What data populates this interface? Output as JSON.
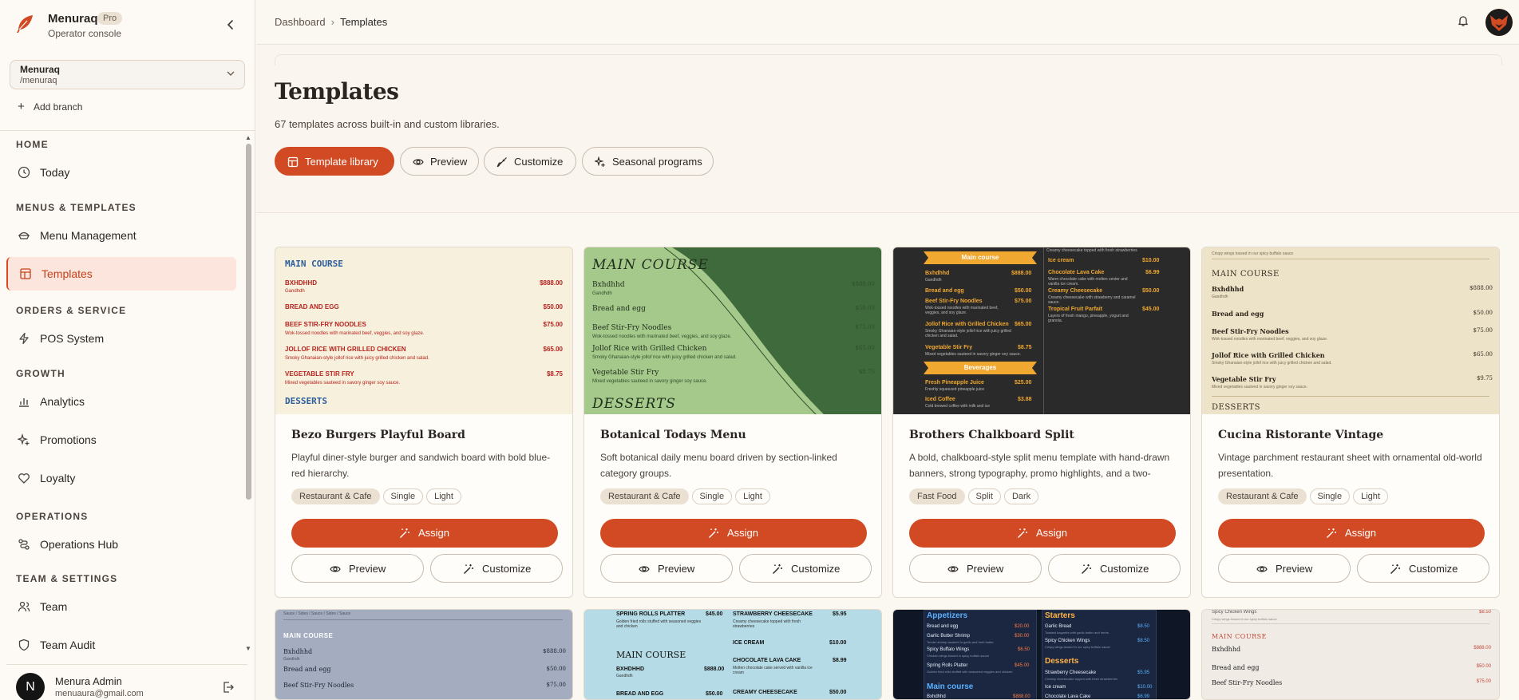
{
  "brand": {
    "name": "Menuraq",
    "badge": "Pro",
    "subtitle": "Operator console"
  },
  "branch": {
    "name": "Menuraq",
    "path": "/menuraq",
    "add_label": "Add branch"
  },
  "nav": {
    "sections": [
      {
        "title": "HOME",
        "items": [
          {
            "label": "Today",
            "icon": "clock-icon"
          }
        ]
      },
      {
        "title": "MENUS & TEMPLATES",
        "items": [
          {
            "label": "Menu Management",
            "icon": "menu-bowl-icon"
          },
          {
            "label": "Templates",
            "icon": "layout-icon",
            "active": true
          }
        ]
      },
      {
        "title": "ORDERS & SERVICE",
        "items": [
          {
            "label": "POS System",
            "icon": "bolt-icon"
          }
        ]
      },
      {
        "title": "GROWTH",
        "items": [
          {
            "label": "Analytics",
            "icon": "bar-chart-icon"
          },
          {
            "label": "Promotions",
            "icon": "sparkle-icon"
          },
          {
            "label": "Loyalty",
            "icon": "heart-icon"
          }
        ]
      },
      {
        "title": "OPERATIONS",
        "items": [
          {
            "label": "Operations Hub",
            "icon": "route-icon"
          }
        ]
      },
      {
        "title": "TEAM & SETTINGS",
        "items": [
          {
            "label": "Team",
            "icon": "users-icon"
          },
          {
            "label": "Team Audit",
            "icon": "shield-icon"
          }
        ]
      }
    ]
  },
  "user": {
    "initial": "N",
    "name": "Menura Admin",
    "email": "menuaura@gmail.com"
  },
  "breadcrumb": {
    "root": "Dashboard",
    "current": "Templates"
  },
  "page": {
    "title": "Templates",
    "subtitle": "67 templates across built-in and custom libraries.",
    "tabs": [
      {
        "label": "Template library",
        "icon": "template-icon",
        "active": true
      },
      {
        "label": "Preview",
        "icon": "eye-icon"
      },
      {
        "label": "Customize",
        "icon": "brush-icon"
      },
      {
        "label": "Seasonal programs",
        "icon": "sparkle-icon"
      }
    ]
  },
  "card_actions": {
    "assign": "Assign",
    "preview": "Preview",
    "customize": "Customize"
  },
  "cards": [
    {
      "title": "Bezo Burgers Playful Board",
      "desc": "Playful diner-style burger and sandwich board with bold blue-red hierarchy.",
      "tags": [
        "Restaurant & Cafe",
        "Single",
        "Light"
      ],
      "preview": {
        "sec1": "MAIN COURSE",
        "items": [
          {
            "name": "BXHDHHD",
            "price": "$888.00",
            "desc": "Gandhdh"
          },
          {
            "name": "BREAD AND EGG",
            "price": "$50.00",
            "desc": ""
          },
          {
            "name": "BEEF STIR-FRY NOODLES",
            "price": "$75.00",
            "desc": "Wok-tossed noodles with marinated beef, veggies, and soy glaze."
          },
          {
            "name": "JOLLOF RICE WITH GRILLED CHICKEN",
            "price": "$65.00",
            "desc": "Smoky Ghanaian-style jollof rice with juicy grilled chicken and salad."
          },
          {
            "name": "VEGETABLE STIR FRY",
            "price": "$8.75",
            "desc": "Mixed vegetables sauteed in savory ginger soy sauce."
          }
        ],
        "sec2": "DESSERTS"
      }
    },
    {
      "title": "Botanical Todays Menu",
      "desc": "Soft botanical daily menu board driven by section-linked category groups.",
      "tags": [
        "Restaurant & Cafe",
        "Single",
        "Light"
      ],
      "preview": {
        "sec1": "MAIN COURSE",
        "items": [
          {
            "name": "Bxhdhhd",
            "price": "$888.00",
            "desc": "Gandhdh"
          },
          {
            "name": "Bread and egg",
            "price": "$50.00",
            "desc": ""
          },
          {
            "name": "Beef Stir-Fry Noodles",
            "price": "$75.00",
            "desc": "Wok-tossed noodles with marinated beef, veggies, and soy glaze."
          },
          {
            "name": "Jollof Rice with Grilled Chicken",
            "price": "$65.00",
            "desc": "Smoky Ghanaian-style jollof rice with juicy grilled chicken and salad."
          },
          {
            "name": "Vegetable Stir Fry",
            "price": "$8.75",
            "desc": "Mixed vegetables sauteed in savory ginger soy sauce."
          }
        ],
        "sec2": "DESSERTS"
      }
    },
    {
      "title": "Brothers Chalkboard Split",
      "desc": "A bold, chalkboard-style split menu template with hand-drawn banners, strong typography, promo highlights, and a two-column…",
      "tags": [
        "Fast Food",
        "Split",
        "Dark"
      ],
      "preview": {
        "top_note": "Creamy cheesecake topped with fresh strawberries",
        "banner1": "Main course",
        "left": [
          {
            "name": "Bxhdhhd",
            "price": "$888.00",
            "desc": "Gandhdh"
          },
          {
            "name": "Bread and egg",
            "price": "$50.00",
            "desc": ""
          },
          {
            "name": "Beef Stir-Fry Noodles",
            "price": "$75.00",
            "desc": "Wok-tossed noodles with marinated beef, veggies, and soy glaze."
          },
          {
            "name": "Jollof Rice with Grilled Chicken",
            "price": "$65.00",
            "desc": "Smoky Ghanaian-style jollof rice with juicy grilled chicken and salad."
          },
          {
            "name": "Vegetable Stir Fry",
            "price": "$8.75",
            "desc": "Mixed vegetables sauteed in savory ginger soy sauce."
          }
        ],
        "banner2": "Beverages",
        "left2": [
          {
            "name": "Fresh Pineapple Juice",
            "price": "$25.00",
            "desc": "Freshly squeezed pineapple juice"
          },
          {
            "name": "Iced Coffee",
            "price": "$3.88",
            "desc": "Cold brewed coffee with milk and ice"
          }
        ],
        "right": [
          {
            "name": "Ice cream",
            "price": "$10.00",
            "desc": ""
          },
          {
            "name": "Chocolate Lava Cake",
            "price": "$6.99",
            "desc": "Warm chocolate cake with molten center and vanilla ice cream."
          },
          {
            "name": "Creamy Cheesecake",
            "price": "$50.00",
            "desc": "Creamy cheesecake with strawberry and caramel sauce."
          },
          {
            "name": "Tropical Fruit Parfait",
            "price": "$45.00",
            "desc": "Layers of fresh mango, pineapple, yogurt and granola."
          }
        ]
      }
    },
    {
      "title": "Cucina Ristorante Vintage",
      "desc": "Vintage parchment restaurant sheet with ornamental old-world presentation.",
      "tags": [
        "Restaurant & Cafe",
        "Single",
        "Light"
      ],
      "preview": {
        "top_note": "Crispy wings tossed in our spicy buffalo sauce",
        "sec1": "MAIN COURSE",
        "items": [
          {
            "name": "Bxhdhhd",
            "price": "$888.00",
            "desc": "Gandhdh"
          },
          {
            "name": "Bread and egg",
            "price": "$50.00",
            "desc": ""
          },
          {
            "name": "Beef Stir-Fry Noodles",
            "price": "$75.00",
            "desc": "Wok-tossed noodles with marinated beef, veggies, and soy glaze."
          },
          {
            "name": "Jollof Rice with Grilled Chicken",
            "price": "$65.00",
            "desc": "Smoky Ghanaian-style jollof rice with juicy grilled chicken and salad."
          },
          {
            "name": "Vegetable Stir Fry",
            "price": "$9.75",
            "desc": "Mixed vegetables sauteed in savory ginger soy sauce."
          }
        ],
        "sec2": "DESSERTS"
      }
    }
  ],
  "row2": [
    {
      "top_note": "Sauce / Sides / Sauce / Sides / Sauce",
      "sec1": "MAIN COURSE",
      "items": [
        {
          "name": "Bxhdhhd",
          "price": "$888.00",
          "desc": "Gandhdh"
        },
        {
          "name": "Bread and egg",
          "price": "$50.00"
        },
        {
          "name": "Beef Stir-Fry Noodles",
          "price": "$75.00"
        }
      ]
    },
    {
      "left": [
        {
          "name": "SPRING ROLLS PLATTER",
          "price": "$45.00",
          "desc": "Golden fried rolls stuffed with seasoned veggies and chicken"
        }
      ],
      "sec1": "MAIN COURSE",
      "left2": [
        {
          "name": "BXHDHHD",
          "price": "$888.00",
          "desc": "Gandhdh"
        },
        {
          "name": "BREAD AND EGG",
          "price": "$50.00"
        }
      ],
      "right": [
        {
          "name": "STRAWBERRY CHEESECAKE",
          "price": "$5.95",
          "desc": "Creamy cheesecake topped with fresh strawberries"
        },
        {
          "name": "ICE CREAM",
          "price": "$10.00"
        },
        {
          "name": "CHOCOLATE LAVA CAKE",
          "price": "$8.99",
          "desc": "Molten chocolate cake served with vanilla ice cream"
        },
        {
          "name": "CREAMY CHEESECAKE",
          "price": "$50.00"
        }
      ]
    },
    {
      "box1": "Appetizers",
      "left": [
        {
          "name": "Bread and egg",
          "price": "$20.00"
        },
        {
          "name": "Garlic Butter Shrimp",
          "price": "$30.00",
          "desc": "Tender shrimp sauteed in garlic and herb butter"
        },
        {
          "name": "Spicy Buffalo Wings",
          "price": "$6.50",
          "desc": "Chicken wings tossed in spicy buffalo sauce"
        },
        {
          "name": "Spring Rolls Platter",
          "price": "$45.00",
          "desc": "Golden fried rolls stuffed with seasoned veggies and chicken"
        }
      ],
      "box2": "Main course",
      "left2": [
        {
          "name": "Bxhdhhd",
          "price": "$888.00"
        }
      ],
      "box3": "Starters",
      "right": [
        {
          "name": "Garlic Bread",
          "price": "$8.50",
          "desc": "Toasted baguette with garlic butter and herbs"
        },
        {
          "name": "Spicy Chicken Wings",
          "price": "$8.50",
          "desc": "Crispy wings tossed in our spicy buffalo sauce"
        }
      ],
      "box4": "Desserts",
      "right2": [
        {
          "name": "Strawberry Cheesecake",
          "price": "$5.95",
          "desc": "Creamy cheesecake topped with fresh strawberries"
        },
        {
          "name": "Ice cream",
          "price": "$10.00"
        },
        {
          "name": "Chocolate Lava Cake",
          "price": "$6.99"
        }
      ]
    },
    {
      "top_note": "Spicy Chicken Wings",
      "top_price": "$8.50",
      "top_desc": "Crispy wings tossed in our spicy buffalo sauce",
      "sec1": "MAIN COURSE",
      "items": [
        {
          "name": "Bxhdhhd",
          "price": "$888.00"
        },
        {
          "name": "Bread and egg",
          "price": "$50.00"
        },
        {
          "name": "Beef Stir-Fry Noodles",
          "price": "$75.00"
        }
      ]
    }
  ],
  "colors": {
    "accent": "#d24a23",
    "sidebar_active_bg": "#fbe5dc",
    "tag_bg": "#ebe1d2",
    "page_bg": "#fbf7f1"
  }
}
